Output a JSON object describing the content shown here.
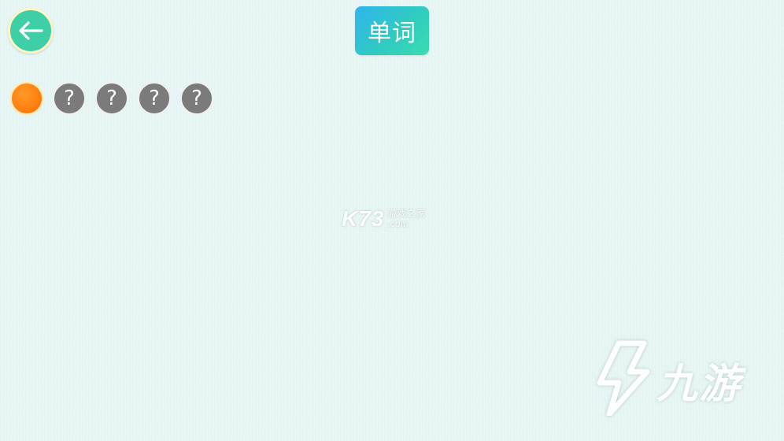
{
  "header": {
    "title": "单词",
    "back_icon": "arrow-left-icon"
  },
  "progress": {
    "total": 5,
    "current_index": 1,
    "locked_glyph": "?",
    "colors": {
      "current": "#ff7f10",
      "locked": "#7b7b7b"
    }
  },
  "watermarks": {
    "center": {
      "brand": "K73",
      "text": "游戏之家",
      "domain": ".com"
    },
    "corner": {
      "text": "九游"
    }
  },
  "colors": {
    "background": "#e6f5f3",
    "back_button": "#3fcfa6",
    "title_badge": "#31b4ee"
  }
}
